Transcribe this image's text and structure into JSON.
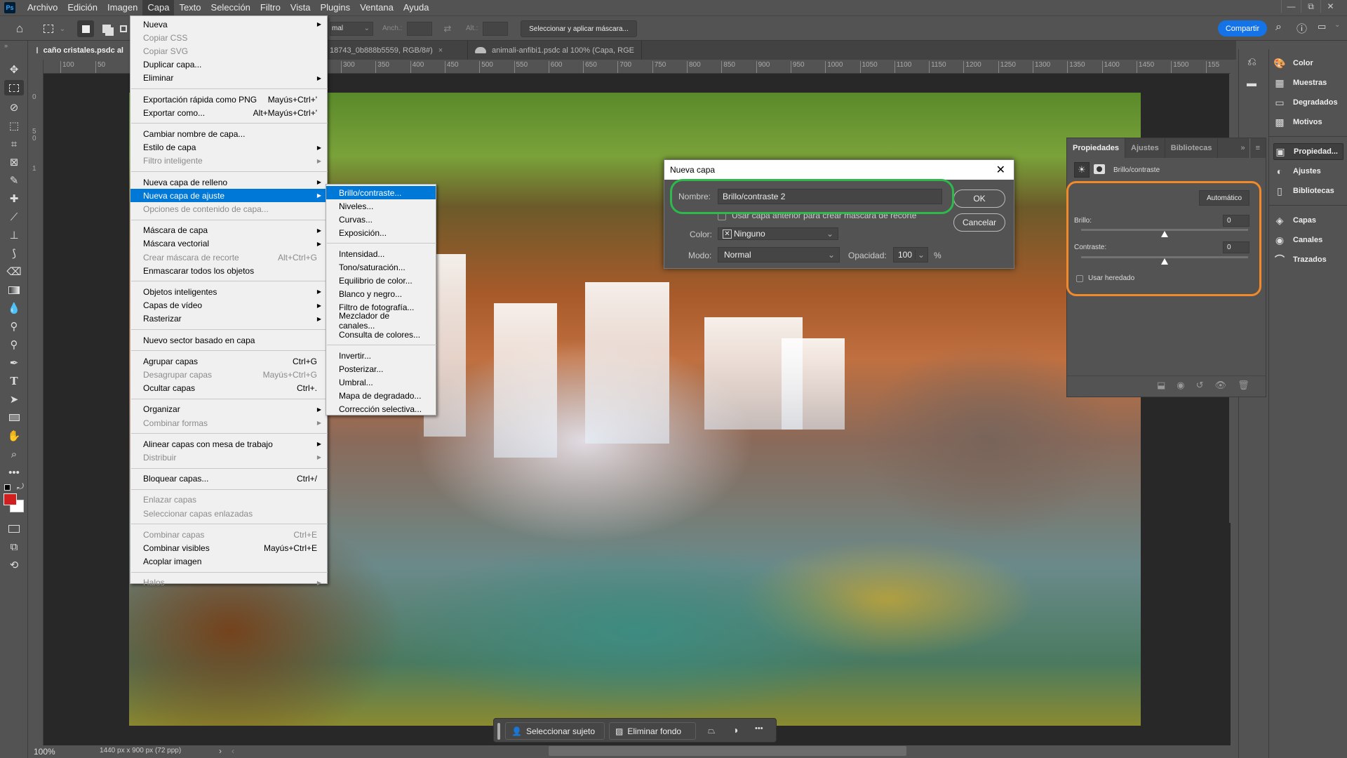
{
  "menubar": {
    "logo": "Ps",
    "items": [
      "Archivo",
      "Edición",
      "Imagen",
      "Capa",
      "Texto",
      "Selección",
      "Filtro",
      "Vista",
      "Plugins",
      "Ventana",
      "Ayuda"
    ],
    "active": "Capa"
  },
  "window_controls": {
    "minimize": "—",
    "restore": "⧉",
    "close": "✕"
  },
  "options_bar": {
    "style_value": "mal",
    "width_label": "Anch.:",
    "height_label": "Alt.:",
    "mask_button": "Seleccionar y aplicar máscara...",
    "share_button": "Compartir"
  },
  "doc_tabs": [
    {
      "label": "caño cristales.psdc al",
      "active": true
    },
    {
      "label": "18743_0b888b5559, RGB/8#)",
      "close": "×",
      "active": false
    },
    {
      "label": "animali-anfibi1.psdc al 100% (Capa, RGE",
      "active": false
    }
  ],
  "ruler_h": [
    "100",
    "50",
    "300",
    "350",
    "400",
    "450",
    "500",
    "550",
    "600",
    "650",
    "700",
    "750",
    "800",
    "850",
    "900",
    "950",
    "1000",
    "1050",
    "1100",
    "1150",
    "1200",
    "1250",
    "1300",
    "1350",
    "1400",
    "1450",
    "1500",
    "155"
  ],
  "ruler_v": [
    "0",
    "5\n0",
    "1"
  ],
  "capa_menu": {
    "items": [
      {
        "label": "Nueva",
        "submenu": true
      },
      {
        "label": "Copiar CSS",
        "disabled": true
      },
      {
        "label": "Copiar SVG",
        "disabled": true
      },
      {
        "label": "Duplicar capa..."
      },
      {
        "label": "Eliminar",
        "submenu": true
      },
      {
        "sep": true
      },
      {
        "label": "Exportación rápida como PNG",
        "shortcut": "Mayús+Ctrl+'"
      },
      {
        "label": "Exportar como...",
        "shortcut": "Alt+Mayús+Ctrl+'"
      },
      {
        "sep": true
      },
      {
        "label": "Cambiar nombre de capa..."
      },
      {
        "label": "Estilo de capa",
        "submenu": true
      },
      {
        "label": "Filtro inteligente",
        "submenu": true,
        "disabled": true
      },
      {
        "sep": true
      },
      {
        "label": "Nueva capa de relleno",
        "submenu": true
      },
      {
        "label": "Nueva capa de ajuste",
        "submenu": true,
        "highlighted": true
      },
      {
        "label": "Opciones de contenido de capa...",
        "disabled": true
      },
      {
        "sep": true
      },
      {
        "label": "Máscara de capa",
        "submenu": true
      },
      {
        "label": "Máscara vectorial",
        "submenu": true
      },
      {
        "label": "Crear máscara de recorte",
        "shortcut": "Alt+Ctrl+G",
        "disabled": true
      },
      {
        "label": "Enmascarar todos los objetos"
      },
      {
        "sep": true
      },
      {
        "label": "Objetos inteligentes",
        "submenu": true
      },
      {
        "label": "Capas de vídeo",
        "submenu": true
      },
      {
        "label": "Rasterizar",
        "submenu": true
      },
      {
        "sep": true
      },
      {
        "label": "Nuevo sector basado en capa"
      },
      {
        "sep": true
      },
      {
        "label": "Agrupar capas",
        "shortcut": "Ctrl+G"
      },
      {
        "label": "Desagrupar capas",
        "shortcut": "Mayús+Ctrl+G",
        "disabled": true
      },
      {
        "label": "Ocultar capas",
        "shortcut": "Ctrl+."
      },
      {
        "sep": true
      },
      {
        "label": "Organizar",
        "submenu": true
      },
      {
        "label": "Combinar formas",
        "submenu": true,
        "disabled": true
      },
      {
        "sep": true
      },
      {
        "label": "Alinear capas con mesa de trabajo",
        "submenu": true
      },
      {
        "label": "Distribuir",
        "submenu": true,
        "disabled": true
      },
      {
        "sep": true
      },
      {
        "label": "Bloquear capas...",
        "shortcut": "Ctrl+/"
      },
      {
        "sep": true
      },
      {
        "label": "Enlazar capas",
        "disabled": true
      },
      {
        "label": "Seleccionar capas enlazadas",
        "disabled": true
      },
      {
        "sep": true
      },
      {
        "label": "Combinar capas",
        "shortcut": "Ctrl+E",
        "disabled": true
      },
      {
        "label": "Combinar visibles",
        "shortcut": "Mayús+Ctrl+E"
      },
      {
        "label": "Acoplar imagen"
      },
      {
        "sep": true
      },
      {
        "label": "Halos",
        "submenu": true,
        "disabled": true
      }
    ]
  },
  "adjust_submenu": {
    "items": [
      {
        "label": "Brillo/contraste...",
        "highlighted": true
      },
      {
        "label": "Niveles..."
      },
      {
        "label": "Curvas..."
      },
      {
        "label": "Exposición..."
      },
      {
        "sep": true
      },
      {
        "label": "Intensidad..."
      },
      {
        "label": "Tono/saturación..."
      },
      {
        "label": "Equilibrio de color..."
      },
      {
        "label": "Blanco y negro..."
      },
      {
        "label": "Filtro de fotografía..."
      },
      {
        "label": "Mezclador de canales..."
      },
      {
        "label": "Consulta de colores..."
      },
      {
        "sep": true
      },
      {
        "label": "Invertir..."
      },
      {
        "label": "Posterizar..."
      },
      {
        "label": "Umbral..."
      },
      {
        "label": "Mapa de degradado..."
      },
      {
        "label": "Corrección selectiva..."
      }
    ]
  },
  "dialog": {
    "title": "Nueva capa",
    "close": "✕",
    "name_label": "Nombre:",
    "name_value": "Brillo/contraste 2",
    "clip_checkbox_label": "Usar capa anterior para crear máscara de recorte",
    "clip_checked": false,
    "color_label": "Color:",
    "color_value": "Ninguno",
    "mode_label": "Modo:",
    "mode_value": "Normal",
    "opacity_label": "Opacidad:",
    "opacity_value": "100",
    "opacity_unit": "%",
    "ok": "OK",
    "cancel": "Cancelar",
    "highlight_color": "#2fb84b"
  },
  "properties_panel": {
    "tabs": [
      "Propiedades",
      "Ajustes",
      "Bibliotecas"
    ],
    "active_tab": "Propiedades",
    "adjustment_name": "Brillo/contraste",
    "auto_button": "Automático",
    "brightness_label": "Brillo:",
    "brightness_value": "0",
    "brightness_fraction": 0.5,
    "contrast_label": "Contraste:",
    "contrast_value": "0",
    "contrast_fraction": 0.5,
    "legacy_label": "Usar heredado",
    "legacy_checked": false,
    "highlight_color": "#f28a2a"
  },
  "panel_dock": {
    "group1": [
      {
        "icon": "palette-icon",
        "glyph": "🎨",
        "label": "Color"
      },
      {
        "icon": "swatches-icon",
        "glyph": "▦",
        "label": "Muestras"
      },
      {
        "icon": "gradient-icon",
        "glyph": "▭",
        "label": "Degradados"
      },
      {
        "icon": "pattern-icon",
        "glyph": "▩",
        "label": "Motivos"
      }
    ],
    "group2": [
      {
        "icon": "properties-icon",
        "glyph": "▣",
        "label": "Propiedad...",
        "active": true
      },
      {
        "icon": "adjustments-icon",
        "glyph": "◐",
        "label": "Ajustes"
      },
      {
        "icon": "libraries-icon",
        "glyph": "▯",
        "label": "Bibliotecas"
      }
    ],
    "group3": [
      {
        "icon": "layers-icon",
        "glyph": "◈",
        "label": "Capas"
      },
      {
        "icon": "channels-icon",
        "glyph": "◉",
        "label": "Canales"
      },
      {
        "icon": "paths-icon",
        "glyph": "⌒",
        "label": "Trazados"
      }
    ]
  },
  "context_bar": {
    "select_subject": "Seleccionar sujeto",
    "remove_bg": "Eliminar fondo",
    "more": "•••"
  },
  "status": {
    "zoom": "100%",
    "doc_info": "1440 px x 900 px (72 ppp)"
  },
  "colors": {
    "foreground": "#d11f1f",
    "background": "#ffffff",
    "accent": "#1473e6",
    "menu_highlight": "#0078d7"
  }
}
